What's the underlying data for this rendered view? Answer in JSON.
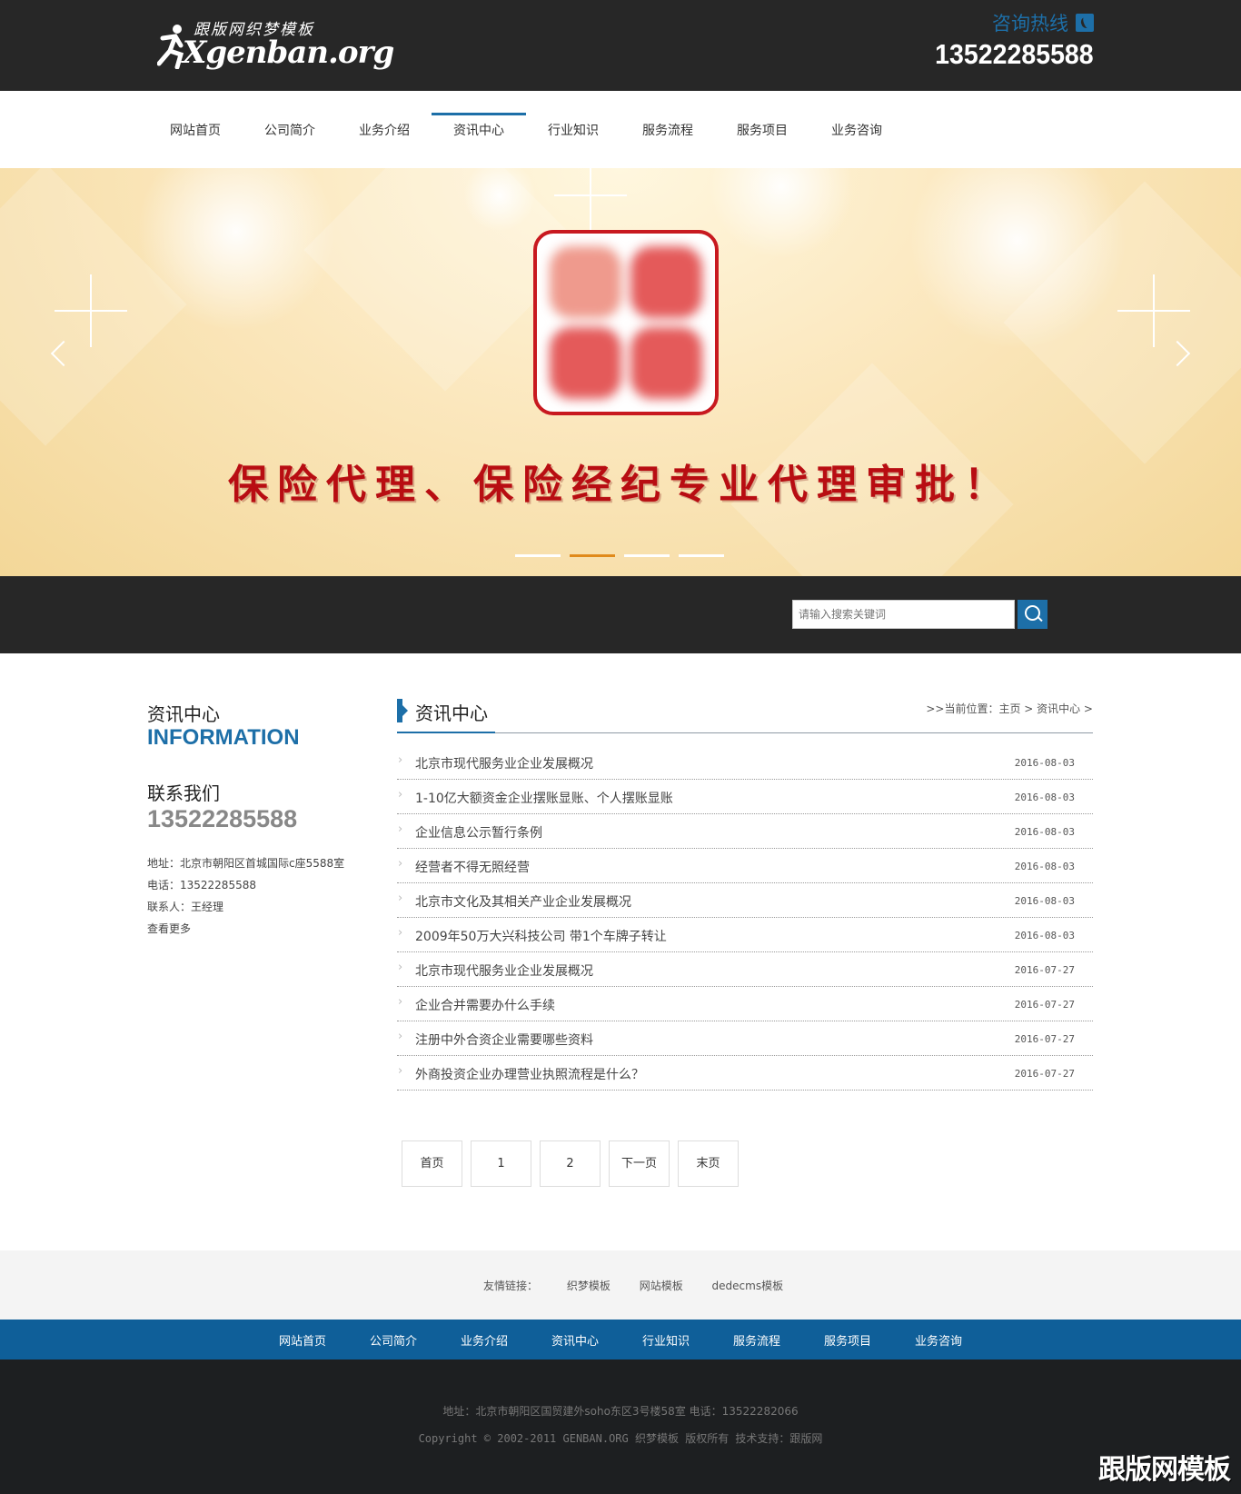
{
  "header": {
    "logo_small": "跟版网织梦模板",
    "logo_big": "Xgenban.org",
    "hotline_label": "咨询热线",
    "hotline_number": "13522285588"
  },
  "nav": {
    "items": [
      {
        "label": "网站首页"
      },
      {
        "label": "公司简介"
      },
      {
        "label": "业务介绍"
      },
      {
        "label": "资讯中心"
      },
      {
        "label": "行业知识"
      },
      {
        "label": "服务流程"
      },
      {
        "label": "服务项目"
      },
      {
        "label": "业务咨询"
      }
    ],
    "active": "资讯中心"
  },
  "banner": {
    "slogan": "保险代理、保险经纪专业代理审批！",
    "slide_count": 4,
    "active_slide": 2
  },
  "search": {
    "placeholder": "请输入搜索关键词"
  },
  "sidebar": {
    "title_cn": "资讯中心",
    "title_en": "INFORMATION",
    "contact_cn": "联系我们",
    "contact_number": "13522285588",
    "address": "地址：北京市朝阳区首城国际c座5588室",
    "phone": "电话：13522285588",
    "contact_person": "联系人：王经理",
    "more": "查看更多"
  },
  "main": {
    "title": "资讯中心",
    "breadcrumb": ">>当前位置：主页 > 资讯中心 >",
    "articles": [
      {
        "title": "北京市现代服务业企业发展概况",
        "date": "2016-08-03"
      },
      {
        "title": "1-10亿大额资金企业摆账显账、个人摆账显账",
        "date": "2016-08-03"
      },
      {
        "title": "企业信息公示暂行条例",
        "date": "2016-08-03"
      },
      {
        "title": "经营者不得无照经营",
        "date": "2016-08-03"
      },
      {
        "title": "北京市文化及其相关产业企业发展概况",
        "date": "2016-08-03"
      },
      {
        "title": "2009年50万大兴科技公司 带1个车牌子转让",
        "date": "2016-08-03"
      },
      {
        "title": "北京市现代服务业企业发展概况",
        "date": "2016-07-27"
      },
      {
        "title": "企业合并需要办什么手续",
        "date": "2016-07-27"
      },
      {
        "title": "注册中外合资企业需要哪些资料",
        "date": "2016-07-27"
      },
      {
        "title": "外商投资企业办理营业执照流程是什么？",
        "date": "2016-07-27"
      }
    ]
  },
  "pager": {
    "first": "首页",
    "p1": "1",
    "p2": "2",
    "next": "下一页",
    "last": "末页"
  },
  "friends": {
    "label": "友情链接：",
    "links": [
      "织梦模板",
      "网站模板",
      "dedecms模板"
    ]
  },
  "footnav": {
    "items": [
      "网站首页",
      "公司简介",
      "业务介绍",
      "资讯中心",
      "行业知识",
      "服务流程",
      "服务项目",
      "业务咨询"
    ]
  },
  "footer": {
    "address": "地址：北京市朝阳区国贸建外soho东区3号楼58室    电话：13522282066",
    "copyright": "Copyright © 2002-2011 GENBAN.ORG 织梦模板 版权所有 技术支持：跟版网",
    "watermark": "跟版网模板"
  },
  "colors": {
    "accent": "#1d6fa8",
    "dark_bar": "#272727",
    "footer_nav": "#0f5f99",
    "slogan_red": "#b80d12",
    "slide_active": "#e08a1b"
  }
}
